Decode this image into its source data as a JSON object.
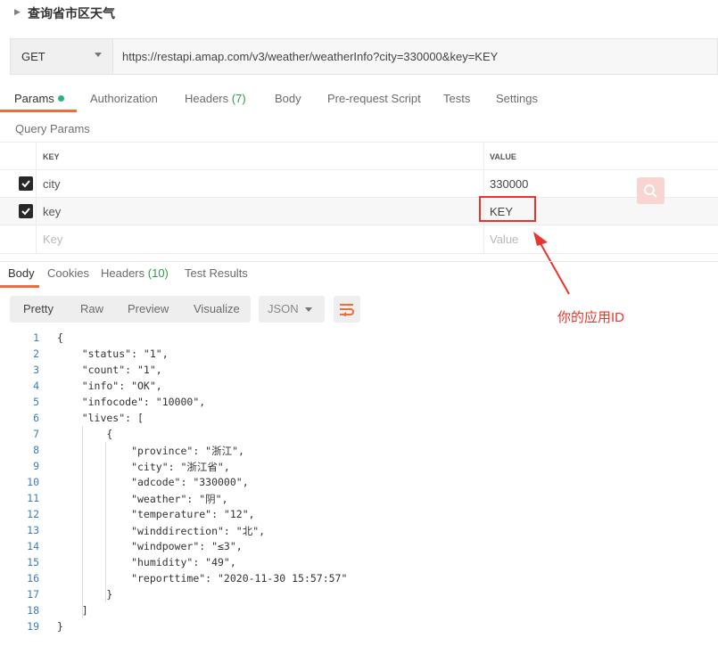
{
  "request": {
    "title": "查询省市区天气",
    "method": "GET",
    "url": "https://restapi.amap.com/v3/weather/weatherInfo?city=330000&key=KEY"
  },
  "request_tabs": [
    {
      "label": "Params"
    },
    {
      "label": "Authorization"
    },
    {
      "label": "Headers",
      "count": "(7)"
    },
    {
      "label": "Body"
    },
    {
      "label": "Pre-request Script"
    },
    {
      "label": "Tests"
    },
    {
      "label": "Settings"
    }
  ],
  "query_params": {
    "section_label": "Query Params",
    "col_key": "KEY",
    "col_value": "VALUE",
    "rows": [
      {
        "key": "city",
        "value": "330000",
        "checked": true
      },
      {
        "key": "key",
        "value": "KEY",
        "checked": true
      }
    ],
    "placeholder_key": "Key",
    "placeholder_value": "Value"
  },
  "annotation": {
    "text": "你的应用ID",
    "color": "#e8362e"
  },
  "response_tabs": [
    {
      "label": "Body"
    },
    {
      "label": "Cookies"
    },
    {
      "label": "Headers",
      "count": "(10)"
    },
    {
      "label": "Test Results"
    }
  ],
  "view_modes": [
    "Pretty",
    "Raw",
    "Preview",
    "Visualize"
  ],
  "format": "JSON",
  "code_lines": [
    {
      "n": "1",
      "text": "{"
    },
    {
      "n": "2",
      "text": "    \"status\": \"1\","
    },
    {
      "n": "3",
      "text": "    \"count\": \"1\","
    },
    {
      "n": "4",
      "text": "    \"info\": \"OK\","
    },
    {
      "n": "5",
      "text": "    \"infocode\": \"10000\","
    },
    {
      "n": "6",
      "text": "    \"lives\": ["
    },
    {
      "n": "7",
      "text": "        {"
    },
    {
      "n": "8",
      "text": "            \"province\": \"浙江\","
    },
    {
      "n": "9",
      "text": "            \"city\": \"浙江省\","
    },
    {
      "n": "10",
      "text": "            \"adcode\": \"330000\","
    },
    {
      "n": "11",
      "text": "            \"weather\": \"阴\","
    },
    {
      "n": "12",
      "text": "            \"temperature\": \"12\","
    },
    {
      "n": "13",
      "text": "            \"winddirection\": \"北\","
    },
    {
      "n": "14",
      "text": "            \"windpower\": \"≤3\","
    },
    {
      "n": "15",
      "text": "            \"humidity\": \"49\","
    },
    {
      "n": "16",
      "text": "            \"reporttime\": \"2020-11-30 15:57:57\""
    },
    {
      "n": "17",
      "text": "        }"
    },
    {
      "n": "18",
      "text": "    ]"
    },
    {
      "n": "19",
      "text": "}"
    }
  ],
  "colors": {
    "accent": "#f26b3a",
    "status_dot": "#26b47f",
    "annotation": "#e8362e"
  }
}
